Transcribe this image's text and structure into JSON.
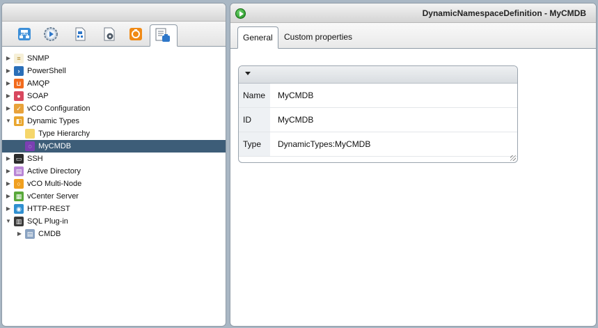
{
  "colors": {
    "selected_row": "#3d5d78",
    "background": "#a9b7c4",
    "run_icon": "#1c8c1c"
  },
  "toolbar": {
    "buttons": [
      {
        "name": "inventory-tab-button",
        "icon": "inventory-icon"
      },
      {
        "name": "workflows-tab-button",
        "icon": "workflow-gear-icon"
      },
      {
        "name": "packages-tab-button",
        "icon": "package-icon"
      },
      {
        "name": "configuration-tab-button",
        "icon": "settings-doc-icon"
      },
      {
        "name": "resources-tab-button",
        "icon": "resource-icon"
      },
      {
        "name": "plugin-tree-tab-button",
        "icon": "plugin-tree-icon",
        "active": true
      }
    ]
  },
  "tree": {
    "items": [
      {
        "label": "SNMP",
        "icon": "snmp-icon",
        "expanded": false
      },
      {
        "label": "PowerShell",
        "icon": "powershell-icon",
        "expanded": false
      },
      {
        "label": "AMQP",
        "icon": "amqp-icon",
        "expanded": false
      },
      {
        "label": "SOAP",
        "icon": "soap-icon",
        "expanded": false
      },
      {
        "label": "vCO Configuration",
        "icon": "vco-config-icon",
        "expanded": false
      },
      {
        "label": "Dynamic Types",
        "icon": "dynamic-types-icon",
        "expanded": true
      },
      {
        "label": "Type Hierarchy",
        "icon": "folder-icon",
        "child": true
      },
      {
        "label": "MyCMDB",
        "icon": "namespace-icon",
        "child": true,
        "selected": true
      },
      {
        "label": "SSH",
        "icon": "ssh-icon",
        "expanded": false
      },
      {
        "label": "Active Directory",
        "icon": "active-directory-icon",
        "expanded": false
      },
      {
        "label": "vCO Multi-Node",
        "icon": "multinode-icon",
        "expanded": false
      },
      {
        "label": "vCenter Server",
        "icon": "vcenter-icon",
        "expanded": false
      },
      {
        "label": "HTTP-REST",
        "icon": "http-rest-icon",
        "expanded": false
      },
      {
        "label": "SQL Plug-in",
        "icon": "sql-plugin-icon",
        "expanded": true
      },
      {
        "label": "CMDB",
        "icon": "database-icon",
        "child": true,
        "expanded": false
      }
    ]
  },
  "right": {
    "title": "DynamicNamespaceDefinition - MyCMDB",
    "tabs": [
      {
        "label": "General"
      },
      {
        "label": "Custom properties"
      }
    ],
    "properties": [
      {
        "key": "Name",
        "value": "MyCMDB"
      },
      {
        "key": "ID",
        "value": "MyCMDB"
      },
      {
        "key": "Type",
        "value": "DynamicTypes:MyCMDB"
      }
    ]
  }
}
